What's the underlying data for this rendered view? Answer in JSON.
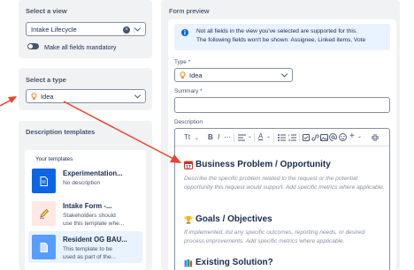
{
  "left": {
    "view_title": "Select a view",
    "view_value": "Intake Lifecycle",
    "mandatory_label": "Make all fields mandatory",
    "type_title": "Select a type",
    "type_value": "Idea",
    "templates_title": "Description templates",
    "your_templates": "Your templates",
    "templates": [
      {
        "title": "Experimentation...",
        "desc1": "No description",
        "desc2": ""
      },
      {
        "title": "Intake Form -...",
        "desc1": "Stakeholders should",
        "desc2": "use this template whe..."
      },
      {
        "title": "Resident OG BAU...",
        "desc1": "This template to be",
        "desc2": "used as part of the..."
      }
    ]
  },
  "preview": {
    "title": "Form preview",
    "notice_line1": "Not all fields in the view you've selected are supported for this.",
    "notice_line2": "The following fields won't be shown: Assignee, Linked items, Vote",
    "type_label": "Type *",
    "type_value": "Idea",
    "summary_label": "Summary *",
    "description_label": "Description",
    "toolbar_text_style": "Tt",
    "toolbar_bold": "B",
    "toolbar_italic": "I",
    "toolbar_font_color": "A",
    "toolbar_more": "+",
    "section1_heading": "Business Problem / Opportunity",
    "section1_text": "Describe the specific problem related to the request or the potential opportunity this request would support. Add specific metrics where applicable.",
    "section2_heading": "Goals / Objectives",
    "section2_text": "If implemented, list any specific outcomes, reporting needs, or desired process improvements. Add specific metrics where applicable.",
    "section3_heading": "Existing Solution?"
  },
  "colors": {
    "accent": "#0c66e4",
    "arrow": "#e8442e",
    "panel_bg": "#f1f2f4",
    "notice_bg": "#e9f2ff"
  }
}
